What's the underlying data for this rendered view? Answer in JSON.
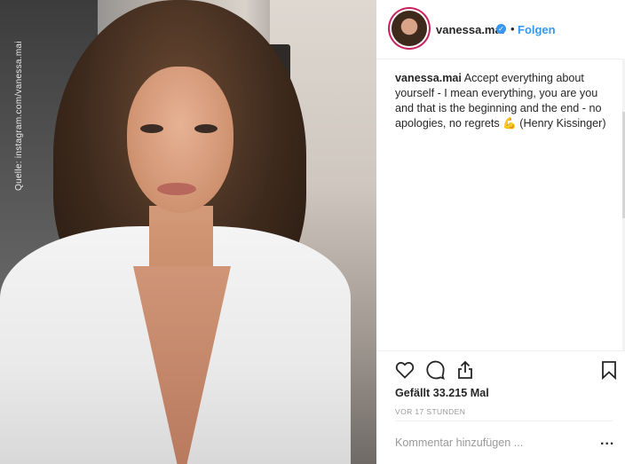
{
  "photo": {
    "credit": "Quelle: instagram.com/vanessa.mai"
  },
  "header": {
    "username": "vanessa.mai",
    "verified_glyph": "✓",
    "separator": "•",
    "follow_label": "Folgen"
  },
  "caption": {
    "username": "vanessa.mai",
    "text": " Accept everything about yourself - I mean everything, you are you and that is the beginning and the end - no apologies, no regrets 💪 (Henry Kissinger)"
  },
  "actions": {
    "like_icon": "heart-icon",
    "comment_icon": "comment-icon",
    "share_icon": "share-icon",
    "save_icon": "bookmark-icon"
  },
  "stats": {
    "likes": "Gefällt 33.215 Mal",
    "time": "VOR 17 STUNDEN"
  },
  "comment": {
    "placeholder": "Kommentar hinzufügen ...",
    "more": "..."
  },
  "colors": {
    "accent": "#3897f0",
    "text": "#262626",
    "muted": "#999999"
  }
}
